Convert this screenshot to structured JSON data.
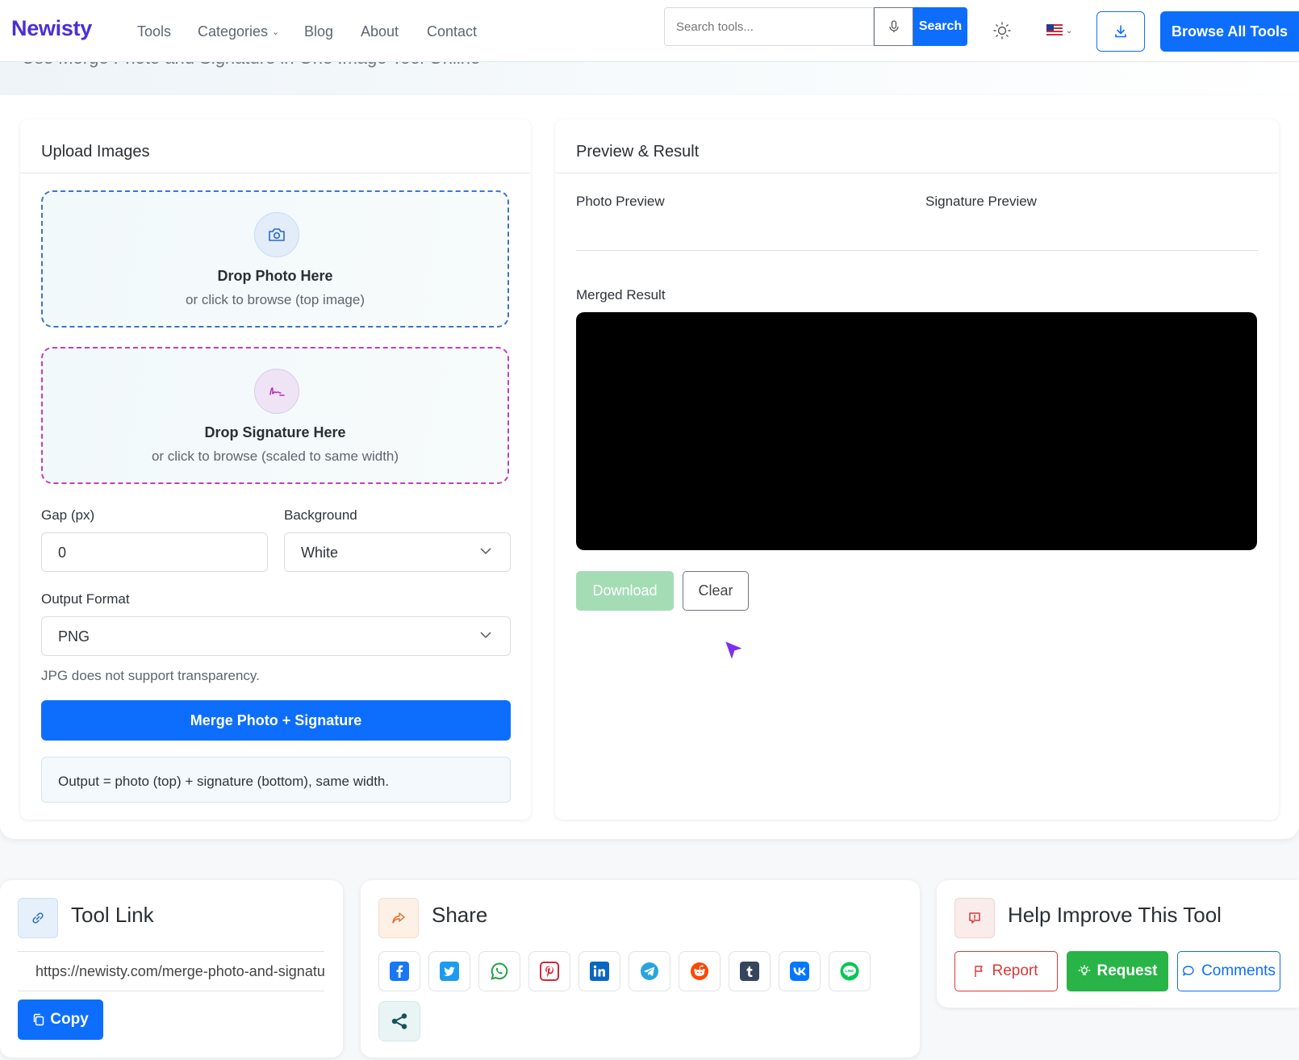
{
  "header": {
    "logo": "Newisty",
    "nav": [
      "Tools",
      "Categories",
      "Blog",
      "About",
      "Contact"
    ],
    "search_placeholder": "Search tools...",
    "search_button": "Search",
    "browse_button": "Browse All Tools"
  },
  "page": {
    "subtitle": "Use Merge Photo and Signature in One Image Tool Online"
  },
  "upload_card": {
    "title": "Upload Images",
    "photo_drop": {
      "title": "Drop Photo Here",
      "subtitle": "or click to browse (top image)"
    },
    "signature_drop": {
      "title": "Drop Signature Here",
      "subtitle": "or click to browse (scaled to same width)"
    },
    "gap_label": "Gap (px)",
    "gap_value": "0",
    "background_label": "Background",
    "background_value": "White",
    "format_label": "Output Format",
    "format_value": "PNG",
    "format_hint": "JPG does not support transparency.",
    "merge_button": "Merge Photo + Signature",
    "note": "Output = photo (top) + signature (bottom), same width."
  },
  "preview_card": {
    "title": "Preview & Result",
    "photo_preview_label": "Photo Preview",
    "signature_preview_label": "Signature Preview",
    "merged_label": "Merged Result",
    "download_button": "Download",
    "clear_button": "Clear"
  },
  "tool_link": {
    "title": "Tool Link",
    "url": "https://newisty.com/merge-photo-and-signature",
    "copy_button": "Copy"
  },
  "share": {
    "title": "Share",
    "networks": [
      "facebook",
      "twitter",
      "whatsapp",
      "pinterest",
      "linkedin",
      "telegram",
      "reddit",
      "tumblr",
      "vk",
      "line",
      "share"
    ]
  },
  "feedback": {
    "title": "Help Improve This Tool",
    "report_button": "Report",
    "request_button": "Request",
    "comments_button": "Comments"
  },
  "colors": {
    "brand": "#4b2fd6",
    "primary": "#0d6efd",
    "success": "#28b446",
    "danger": "#d63a3a"
  }
}
